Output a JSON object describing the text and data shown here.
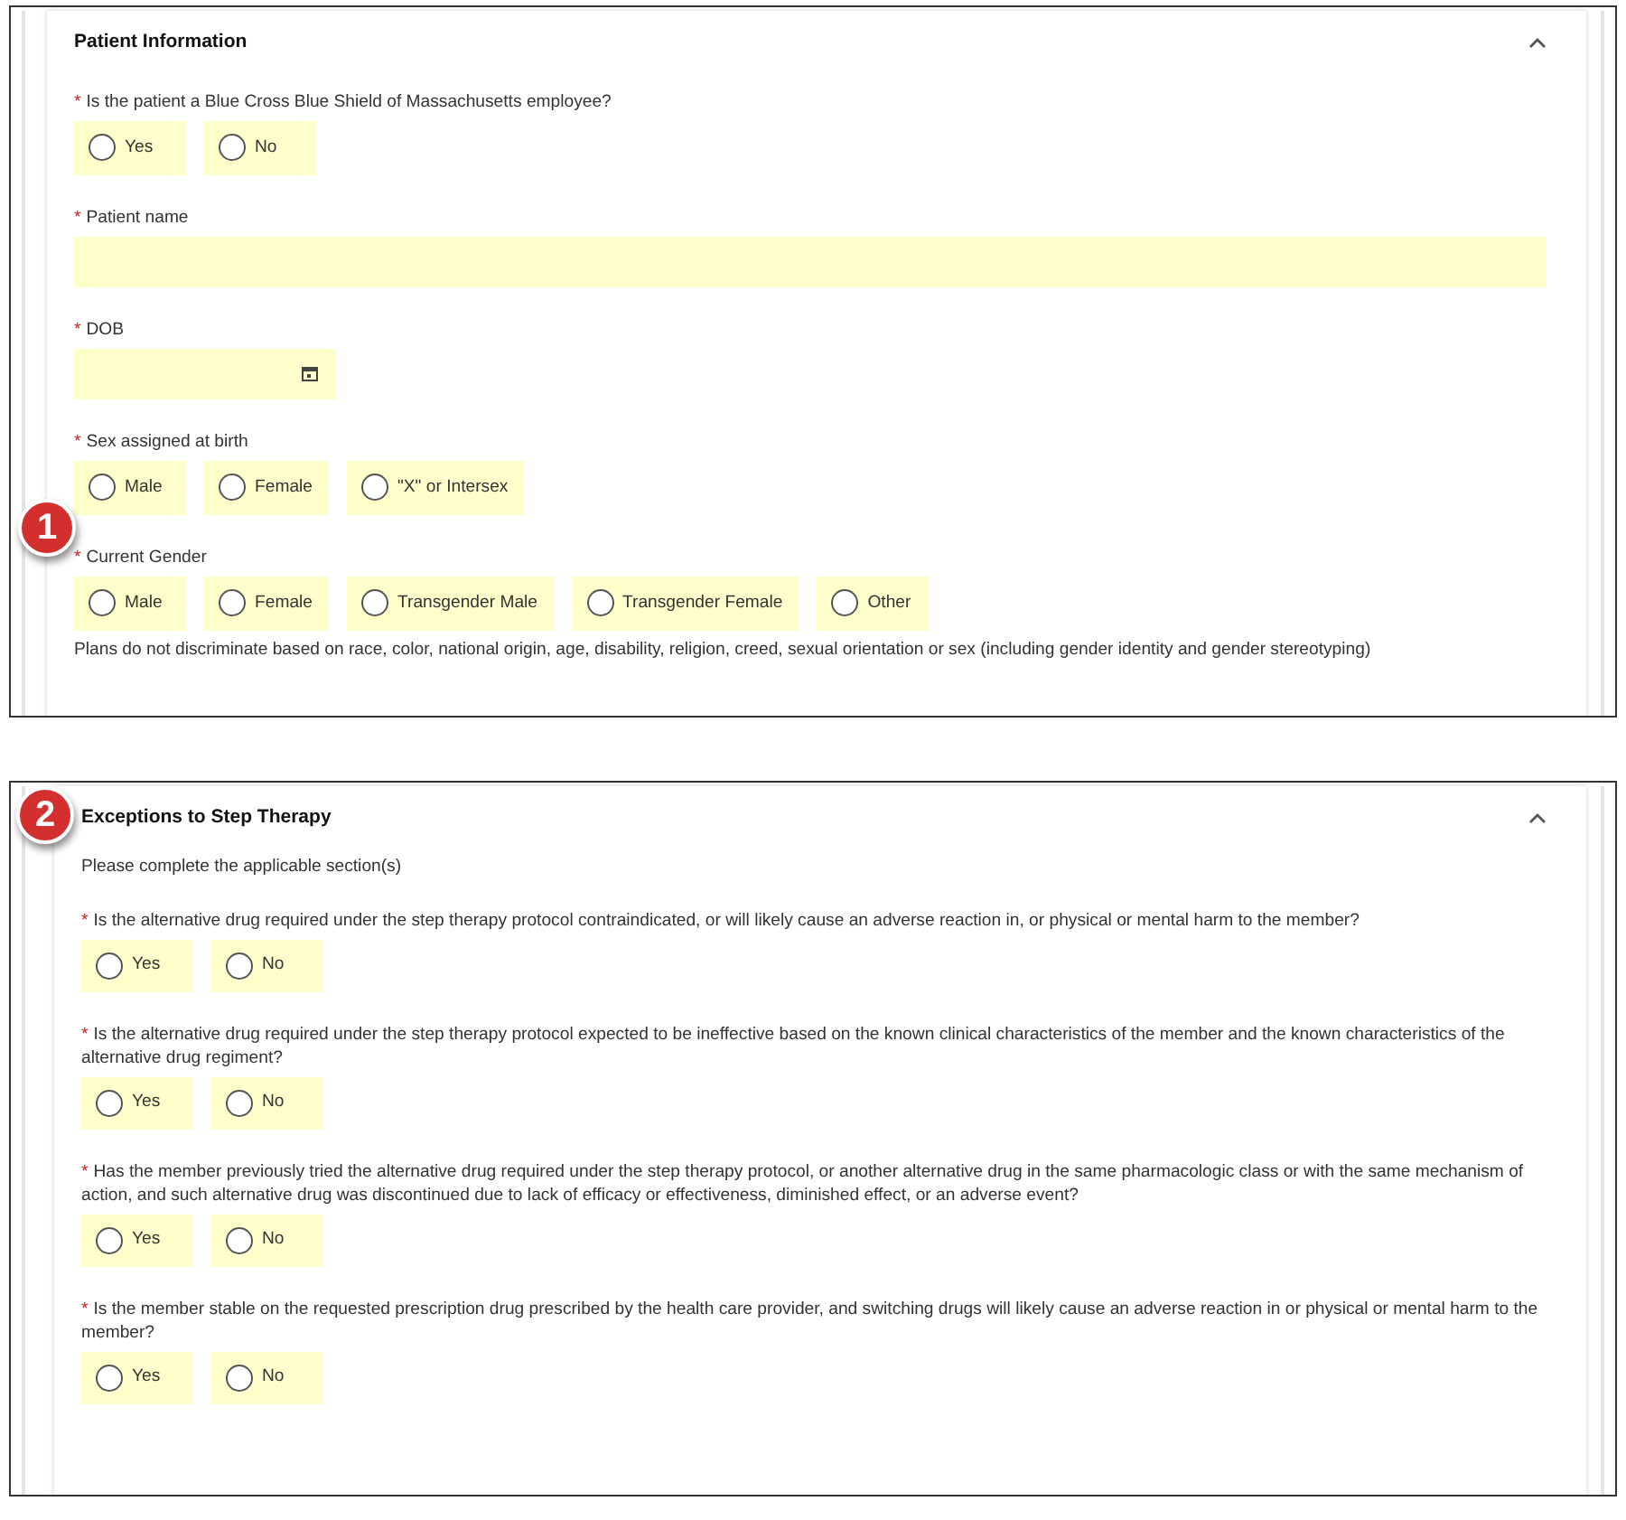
{
  "panels": [
    {
      "title": "Patient Information",
      "expanded": true,
      "fields": [
        {
          "kind": "radio",
          "marker": "*",
          "label": "Is the patient a Blue Cross Blue Shield of Massachusetts employee?",
          "options": [
            {
              "label": "Yes",
              "selected": false
            },
            {
              "label": "No",
              "selected": false
            }
          ]
        },
        {
          "kind": "text",
          "marker": "*",
          "label": "Patient name"
        },
        {
          "kind": "date",
          "marker": "*",
          "label": "DOB"
        },
        {
          "kind": "radio",
          "marker": "*",
          "label": "Sex assigned at birth",
          "options": [
            {
              "label": "Male",
              "selected": false
            },
            {
              "label": "Female",
              "selected": false
            },
            {
              "label": "\"X\" or Intersex",
              "selected": false
            }
          ]
        },
        {
          "kind": "radio",
          "badge": "1",
          "marker": "*",
          "label": "Current Gender",
          "options": [
            {
              "label": "Male",
              "selected": false
            },
            {
              "label": "Female",
              "selected": false
            },
            {
              "label": "Transgender Male",
              "selected": false
            },
            {
              "label": "Transgender Female",
              "selected": false
            },
            {
              "label": "Other",
              "selected": false
            }
          ],
          "note": "Plans do not discriminate based on race, color, national origin, age, disability, religion, creed, sexual orientation or sex (including gender identity and gender stereotyping)"
        }
      ]
    },
    {
      "badge": "2",
      "title": "Exceptions to Step Therapy",
      "expanded": true,
      "fields": [
        {
          "kind": "info",
          "text": "Please complete the applicable section(s)"
        },
        {
          "kind": "radio",
          "marker": "*",
          "label": "Is the alternative drug required under the step therapy protocol contraindicated, or will likely cause an adverse reaction in, or physical or mental harm to the member?",
          "options": [
            {
              "label": "Yes",
              "selected": false
            },
            {
              "label": "No",
              "selected": false
            }
          ]
        },
        {
          "kind": "radio",
          "marker": "*",
          "label": "Is the alternative drug required under the step therapy protocol expected to be ineffective based on the known clinical characteristics of the member and the known characteristics of the alternative drug regiment?",
          "options": [
            {
              "label": "Yes",
              "selected": false
            },
            {
              "label": "No",
              "selected": false
            }
          ]
        },
        {
          "kind": "radio",
          "marker": "*",
          "label": "Has the member previously tried the alternative drug required under the step therapy protocol, or another alternative drug in the same pharmacologic class or with the same mechanism of action, and such alternative drug was discontinued due to lack of efficacy or effectiveness, diminished effect, or an adverse event?",
          "options": [
            {
              "label": "Yes",
              "selected": false
            },
            {
              "label": "No",
              "selected": false
            }
          ]
        },
        {
          "kind": "radio",
          "marker": "*",
          "label": "Is the member stable on the requested prescription drug prescribed by the health care provider, and switching drugs will likely cause an adverse reaction in or physical or mental harm to the member?",
          "options": [
            {
              "label": "Yes",
              "selected": false
            },
            {
              "label": "No",
              "selected": false
            }
          ]
        }
      ]
    }
  ]
}
